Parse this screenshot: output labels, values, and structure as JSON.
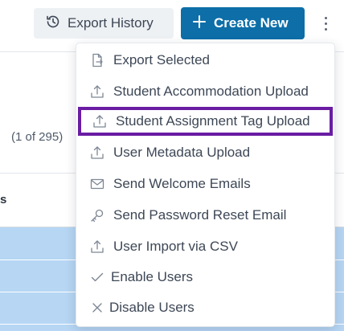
{
  "toolbar": {
    "export_history_label": "Export History",
    "create_new_label": "Create New",
    "accent_color": "#0d6ea8"
  },
  "list": {
    "pager_count": "(1 of 295)",
    "column_header_fragment": "s"
  },
  "menu": {
    "highlight_color": "#6a1ca3",
    "items": [
      {
        "label": "Export Selected",
        "icon": "export-file-icon"
      },
      {
        "label": "Student Accommodation Upload",
        "icon": "upload-icon"
      },
      {
        "label": "Student Assignment Tag Upload",
        "icon": "upload-icon",
        "highlighted": true
      },
      {
        "label": "User Metadata Upload",
        "icon": "upload-icon"
      },
      {
        "label": "Send Welcome Emails",
        "icon": "envelope-icon"
      },
      {
        "label": "Send Password Reset Email",
        "icon": "key-icon"
      },
      {
        "label": "User Import via CSV",
        "icon": "upload-icon"
      },
      {
        "label": "Enable Users",
        "icon": "check-icon"
      },
      {
        "label": "Disable Users",
        "icon": "x-icon"
      }
    ]
  }
}
